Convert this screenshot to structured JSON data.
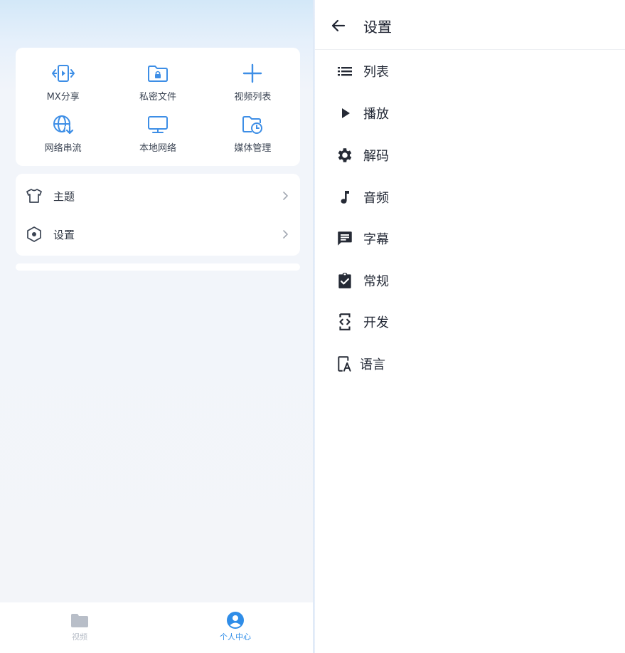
{
  "profile": {
    "grid": [
      {
        "label": "MX分享",
        "icon": "mx-share-icon"
      },
      {
        "label": "私密文件",
        "icon": "private-folder-icon"
      },
      {
        "label": "视频列表",
        "icon": "plus-icon"
      },
      {
        "label": "网络串流",
        "icon": "network-stream-icon"
      },
      {
        "label": "本地网络",
        "icon": "monitor-icon"
      },
      {
        "label": "媒体管理",
        "icon": "media-manage-icon"
      }
    ],
    "menu": [
      {
        "label": "主题",
        "icon": "tshirt-icon"
      },
      {
        "label": "设置",
        "icon": "settings-hex-icon"
      }
    ]
  },
  "bottom_nav": [
    {
      "label": "视频",
      "icon": "folder-icon",
      "active": false
    },
    {
      "label": "个人中心",
      "icon": "account-icon",
      "active": true
    }
  ],
  "settings": {
    "title": "设置",
    "items": [
      {
        "label": "列表",
        "icon": "list-icon"
      },
      {
        "label": "播放",
        "icon": "play-icon"
      },
      {
        "label": "解码",
        "icon": "gear-icon"
      },
      {
        "label": "音频",
        "icon": "music-note-icon"
      },
      {
        "label": "字幕",
        "icon": "subtitle-icon"
      },
      {
        "label": "常规",
        "icon": "clipboard-check-icon"
      },
      {
        "label": "开发",
        "icon": "developer-icon"
      },
      {
        "label": "语言",
        "icon": "language-icon"
      }
    ]
  },
  "colors": {
    "accent": "#3d8ee6",
    "active_nav": "#2f8de8",
    "inactive_nav": "#b8bec8",
    "icon_dark": "#252a35"
  }
}
